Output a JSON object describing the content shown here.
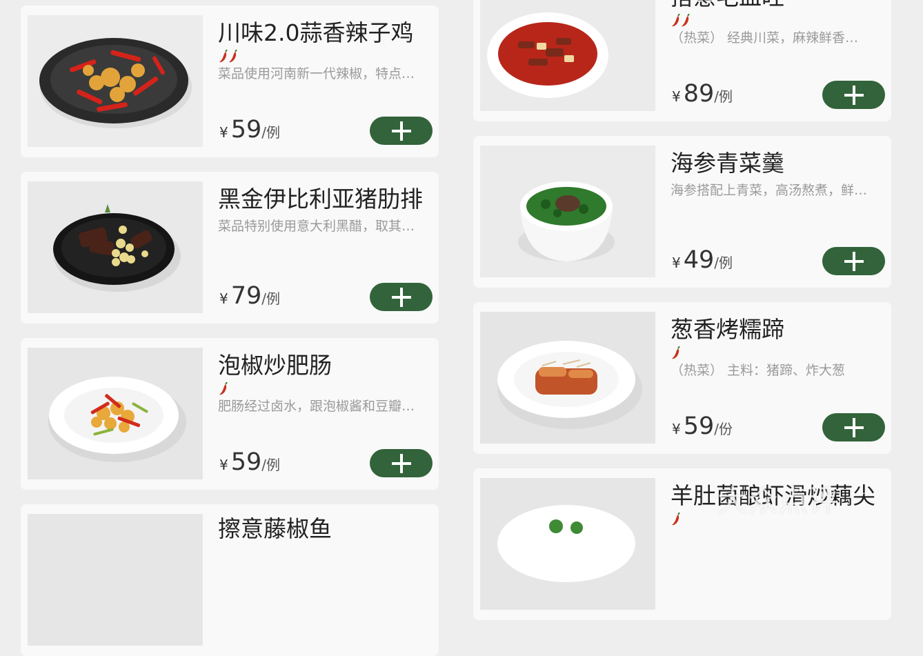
{
  "left_column": [
    {
      "name": "川味2.0蒜香辣子鸡",
      "spice_level": 2,
      "description": "菜品使用河南新一代辣椒，特点…",
      "currency": "¥",
      "price": "59",
      "unit": "/例",
      "add_icon": "plus-icon",
      "dish": "chili-chicken"
    },
    {
      "name": "黑金伊比利亚猪肋排",
      "spice_level": 0,
      "description": "菜品特别使用意大利黑醋，取其…",
      "currency": "¥",
      "price": "79",
      "unit": "/例",
      "add_icon": "plus-icon",
      "dish": "pork-ribs"
    },
    {
      "name": "泡椒炒肥肠",
      "spice_level": 1,
      "description": "肥肠经过卤水，跟泡椒酱和豆瓣…",
      "currency": "¥",
      "price": "59",
      "unit": "/例",
      "add_icon": "plus-icon",
      "dish": "pickled-pepper-intestine"
    },
    {
      "name": "擦意藤椒鱼",
      "spice_level": 0,
      "description": "",
      "currency": "",
      "price": "",
      "unit": "",
      "add_icon": "",
      "dish": "partial"
    }
  ],
  "right_column": [
    {
      "name": "搭意毛血旺",
      "spice_level": 2,
      "description": "（热菜） 经典川菜，麻辣鲜香…",
      "currency": "¥",
      "price": "89",
      "unit": "/例",
      "add_icon": "plus-icon",
      "dish": "maoxuewang"
    },
    {
      "name": "海参青菜羹",
      "spice_level": 0,
      "description": "海参搭配上青菜，高汤熬煮，鲜…",
      "currency": "¥",
      "price": "49",
      "unit": "/例",
      "add_icon": "plus-icon",
      "dish": "sea-cucumber-soup"
    },
    {
      "name": "葱香烤糯蹄",
      "spice_level": 1,
      "description": "（热菜） 主料：猪蹄、炸大葱",
      "currency": "¥",
      "price": "59",
      "unit": "/份",
      "add_icon": "plus-icon",
      "dish": "roast-trotter"
    },
    {
      "name": "羊肚菌酿虾滑炒藕尖",
      "spice_level": 1,
      "description": "",
      "currency": "",
      "price": "",
      "unit": "",
      "add_icon": "",
      "dish": "partial"
    }
  ],
  "watermark": "大众点评",
  "colors": {
    "add_button": "#32633a",
    "background": "#eeeeee",
    "card": "#f9f9f9",
    "name": "#222222",
    "description": "#9a9a9a",
    "chili": "#c8321e"
  }
}
